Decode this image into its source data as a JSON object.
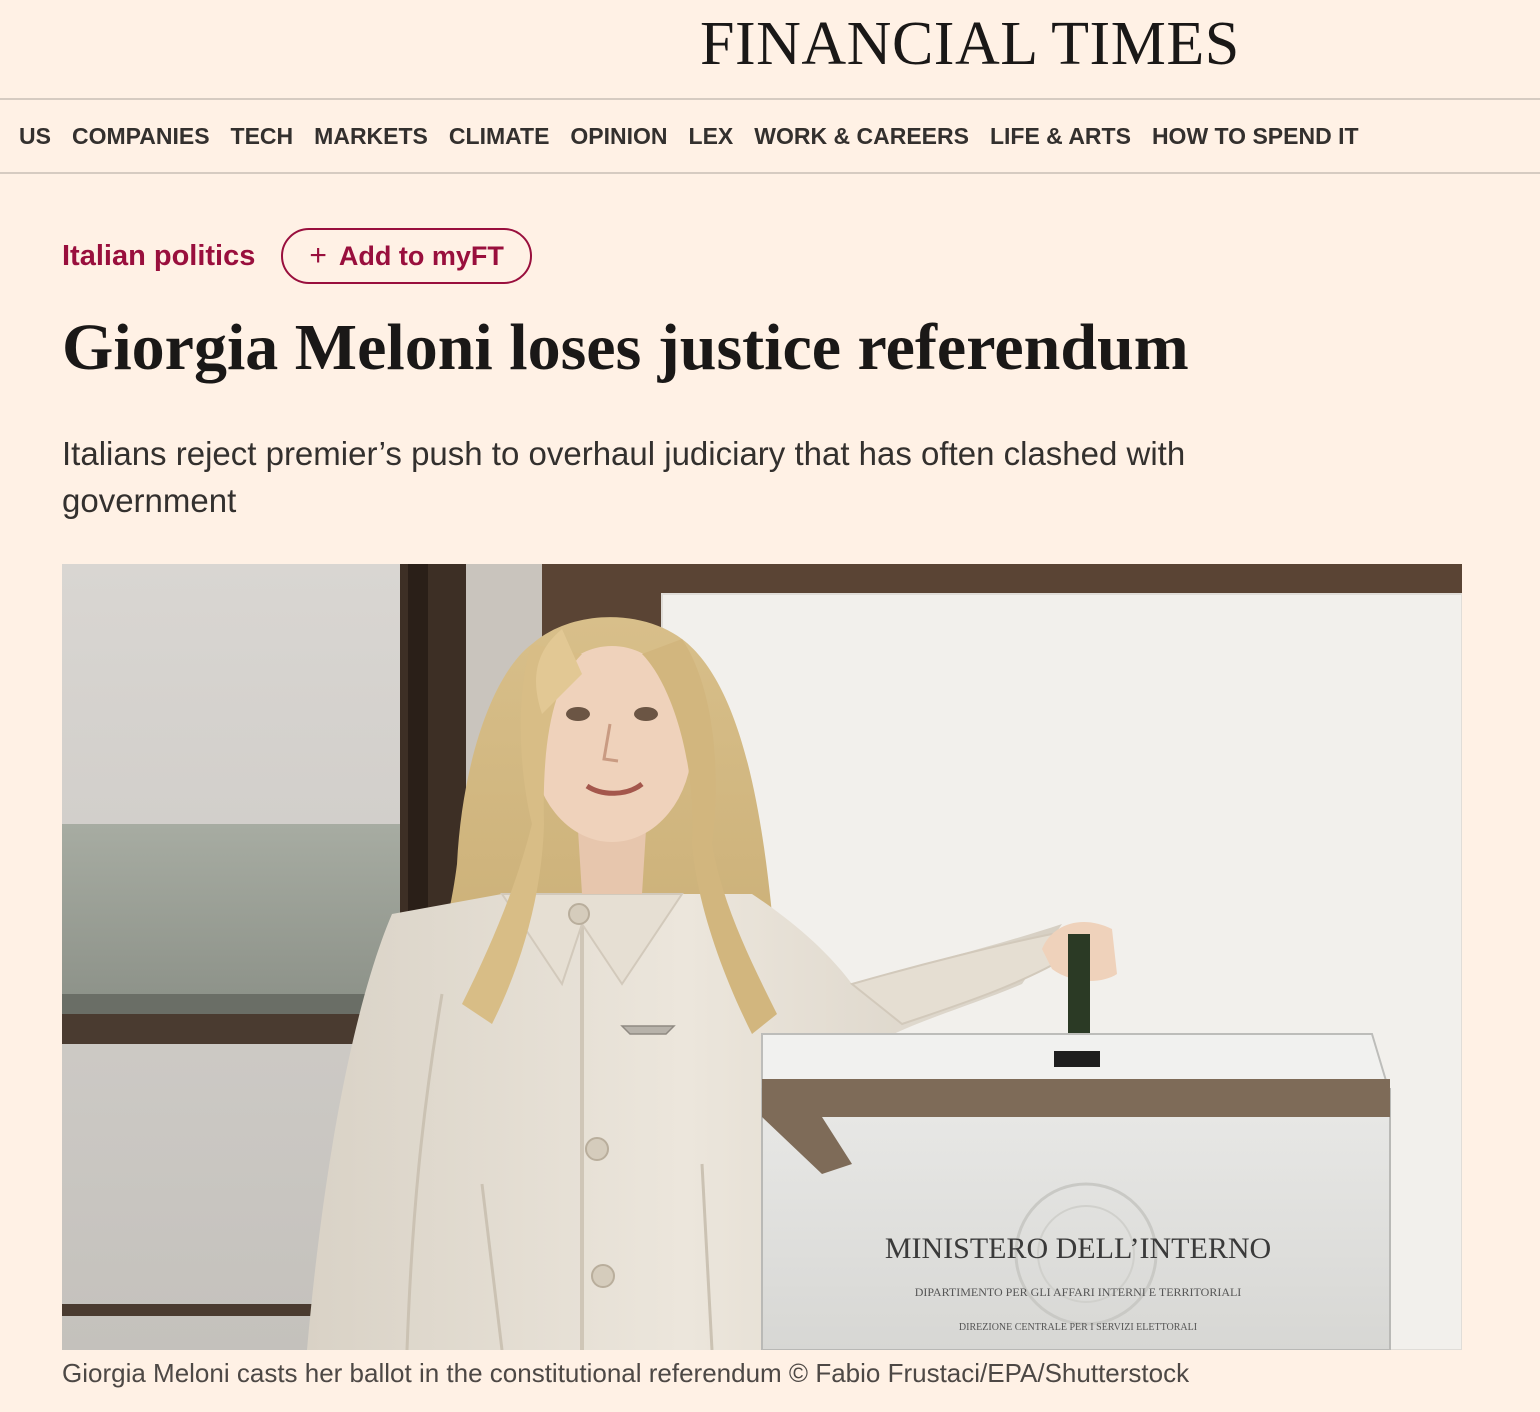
{
  "masthead": {
    "logo_text": "FINANCIAL TIMES"
  },
  "nav": {
    "items": [
      {
        "label": "US"
      },
      {
        "label": "COMPANIES"
      },
      {
        "label": "TECH"
      },
      {
        "label": "MARKETS"
      },
      {
        "label": "CLIMATE"
      },
      {
        "label": "OPINION"
      },
      {
        "label": "LEX"
      },
      {
        "label": "WORK & CAREERS"
      },
      {
        "label": "LIFE & ARTS"
      },
      {
        "label": "HOW TO SPEND IT"
      }
    ]
  },
  "article": {
    "topic": "Italian politics",
    "myft_label": "Add to myFT",
    "myft_icon": "plus-icon",
    "headline": "Giorgia Meloni loses justice referendum",
    "standfirst": "Italians reject premier’s push to overhaul judiciary that has often clashed with government",
    "image": {
      "ballot_box_title": "MINISTERO DELL’INTERNO",
      "ballot_box_line2": "DIPARTIMENTO PER GLI AFFARI INTERNI E TERRITORIALI",
      "ballot_box_line3": "DIREZIONE CENTRALE PER I SERVIZI ELETTORALI"
    },
    "caption": "Giorgia Meloni casts her ballot in the constitutional referendum © Fabio Frustaci/EPA/Shutterstock"
  },
  "colors": {
    "background": "#fff1e5",
    "accent": "#990f3d",
    "text": "#33302e"
  }
}
